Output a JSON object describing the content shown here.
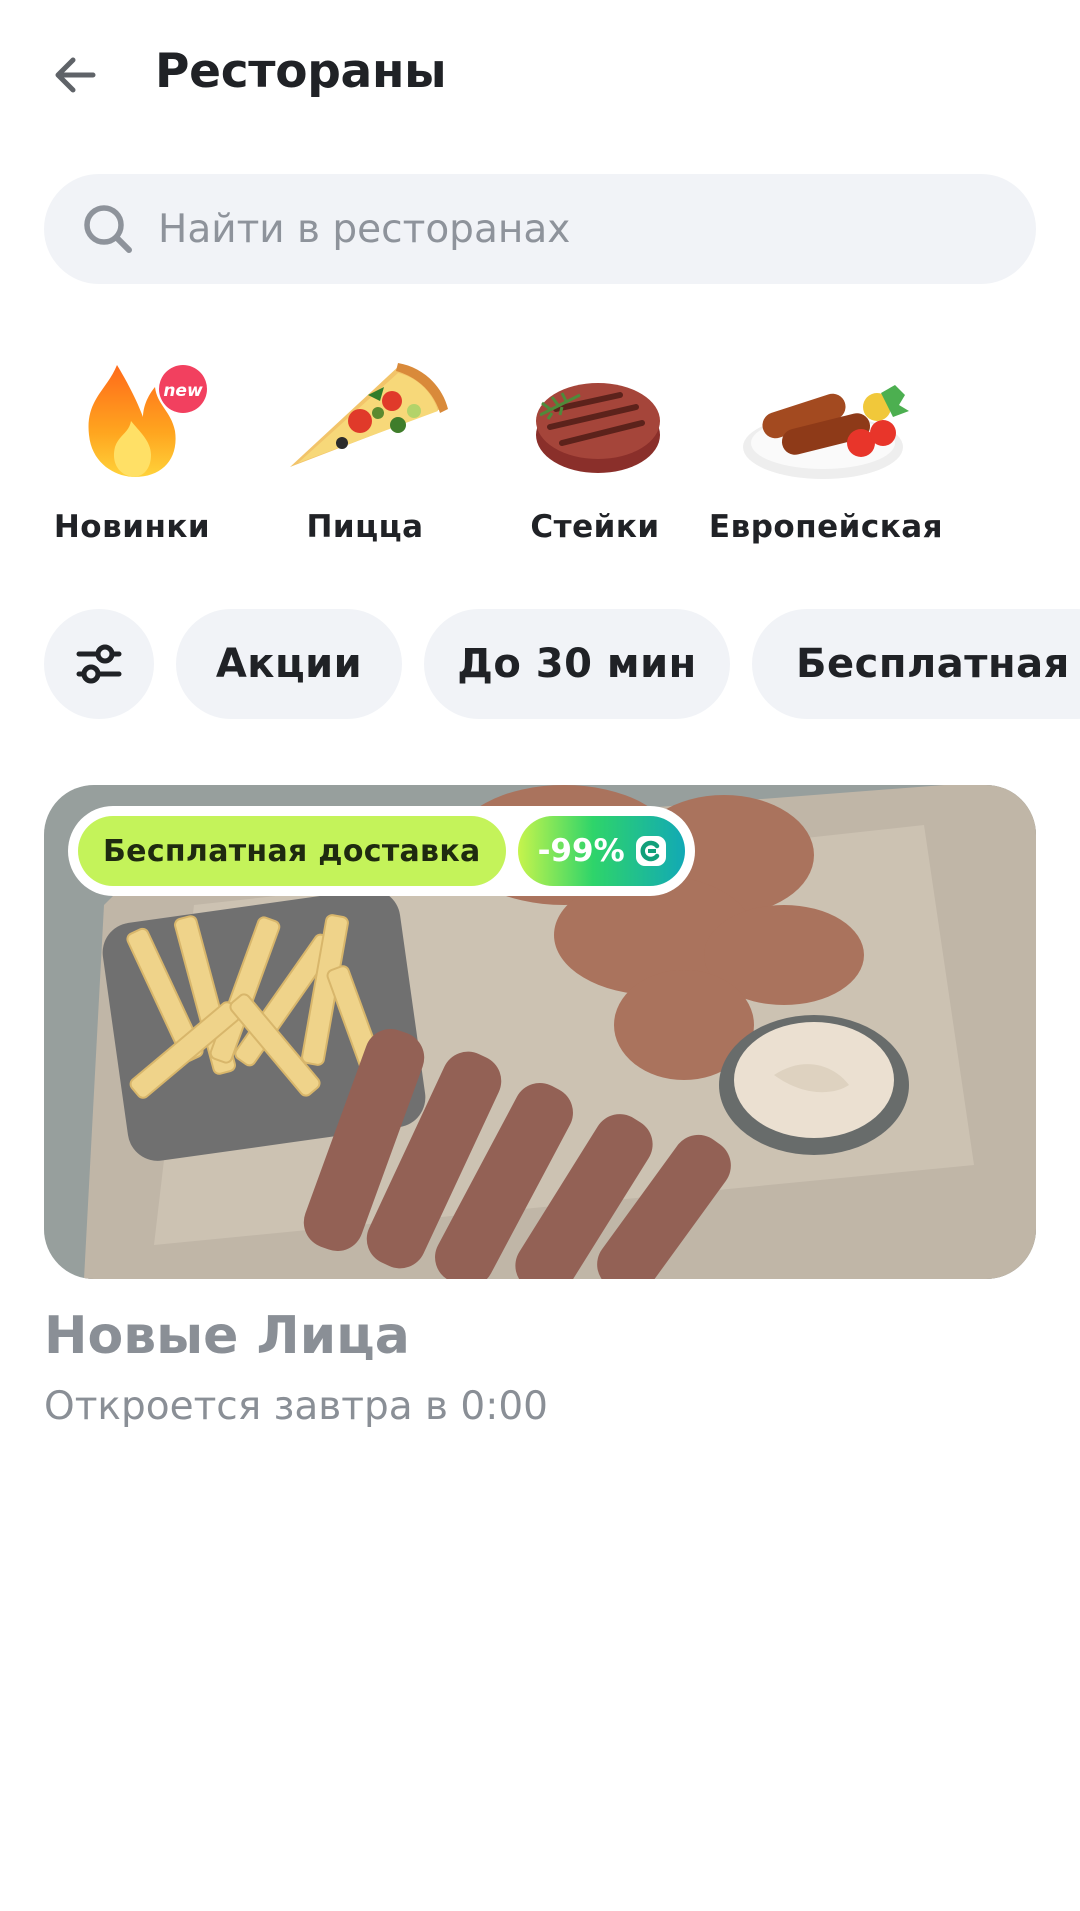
{
  "header": {
    "title": "Рестораны",
    "back_icon": "arrow-left-icon"
  },
  "search": {
    "placeholder": "Найти в ресторанах",
    "value": "",
    "icon": "search-icon"
  },
  "categories": [
    {
      "label": "Новинки",
      "icon": "fire-new-icon",
      "badge": "new"
    },
    {
      "label": "Пицца",
      "icon": "pizza-icon"
    },
    {
      "label": "Стейки",
      "icon": "steak-icon"
    },
    {
      "label": "Европейская",
      "icon": "sausage-plate-icon"
    }
  ],
  "filters": {
    "settings_icon": "sliders-icon",
    "chips": [
      "Акции",
      "До 30 мин",
      "Бесплатная доставка"
    ]
  },
  "restaurant": {
    "badge_free": "Бесплатная доставка",
    "badge_discount": "-99%",
    "discount_icon": "coin-icon",
    "name": "Новые Лица",
    "status": "Откроется завтра в 0:00"
  },
  "colors": {
    "chip_bg": "#f1f3f7",
    "accent_lime": "#c4f35a",
    "text_primary": "#202226",
    "text_muted": "#8a8f96"
  }
}
